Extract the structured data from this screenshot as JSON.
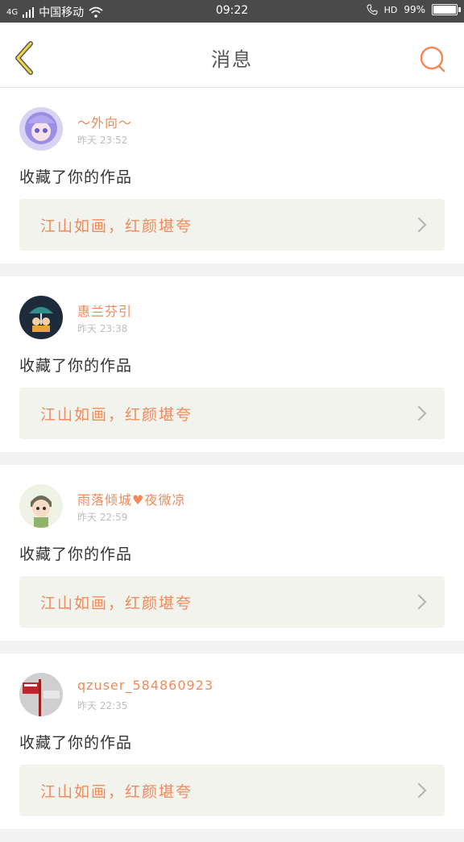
{
  "status_bar": {
    "signal": "4G",
    "carrier": "中国移动",
    "time": "09:22",
    "hd": "HD",
    "battery": "99%"
  },
  "header": {
    "title": "消息",
    "back_icon": "chevron-left-icon",
    "search_icon": "search-icon"
  },
  "colors": {
    "accent": "#f08a5b",
    "back_yellow": "#f2d648",
    "card_bg": "#ffffff",
    "work_bg": "#f3f3ee"
  },
  "messages": [
    {
      "user": "～外向～",
      "time": "昨天 23:52",
      "action": "收藏了你的作品",
      "work_title": "江山如画，红颜堪夸"
    },
    {
      "user": "惠兰芬引",
      "time": "昨天 23:38",
      "action": "收藏了你的作品",
      "work_title": "江山如画，红颜堪夸"
    },
    {
      "user": "雨落倾城♥夜微凉",
      "time": "昨天 22:59",
      "action": "收藏了你的作品",
      "work_title": "江山如画，红颜堪夸"
    },
    {
      "user": "qzuser_584860923",
      "time": "昨天 22:35",
      "action": "收藏了你的作品",
      "work_title": "江山如画，红颜堪夸"
    }
  ]
}
